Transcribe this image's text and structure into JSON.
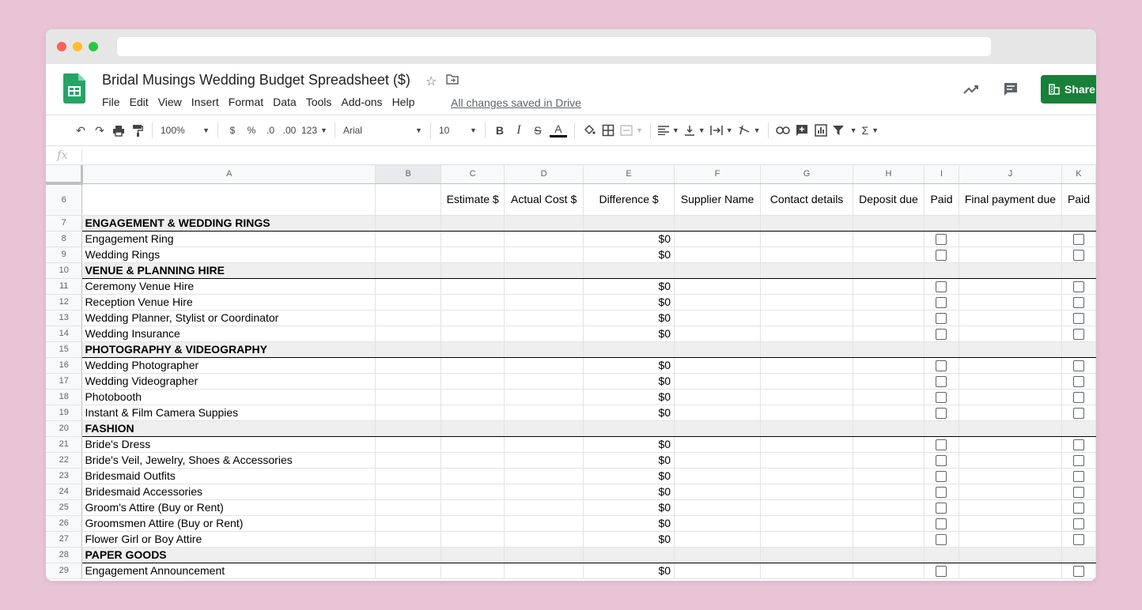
{
  "header": {
    "title": "Bridal Musings Wedding Budget Spreadsheet ($)",
    "menu": [
      "File",
      "Edit",
      "View",
      "Insert",
      "Format",
      "Data",
      "Tools",
      "Add-ons",
      "Help"
    ],
    "saved_status": "All changes saved in Drive",
    "share_label": "Share"
  },
  "toolbar": {
    "zoom": "100%",
    "currency": "$",
    "percent": "%",
    "decrease_decimals": ".0",
    "increase_decimals": ".00",
    "more_formats": "123",
    "font": "Arial",
    "font_size": "10"
  },
  "formula_bar": {
    "fx": "fx"
  },
  "sheet": {
    "columns": [
      "A",
      "B",
      "C",
      "D",
      "E",
      "F",
      "G",
      "H",
      "I",
      "J",
      "K"
    ],
    "header_row": {
      "number": "6",
      "labels": [
        "",
        "",
        "Estimate $",
        "Actual Cost $",
        "Difference $",
        "Supplier Name",
        "Contact details",
        "Deposit due",
        "Paid",
        "Final payment due",
        "Paid"
      ]
    },
    "rows": [
      {
        "n": "7",
        "type": "section",
        "label": "ENGAGEMENT & WEDDING RINGS"
      },
      {
        "n": "8",
        "type": "item",
        "label": "Engagement Ring",
        "diff": "$0"
      },
      {
        "n": "9",
        "type": "item",
        "label": "Wedding Rings",
        "diff": "$0"
      },
      {
        "n": "10",
        "type": "section",
        "label": "VENUE & PLANNING HIRE"
      },
      {
        "n": "11",
        "type": "item",
        "label": "Ceremony Venue Hire",
        "diff": "$0"
      },
      {
        "n": "12",
        "type": "item",
        "label": "Reception Venue Hire",
        "diff": "$0"
      },
      {
        "n": "13",
        "type": "item",
        "label": "Wedding Planner, Stylist or Coordinator",
        "diff": "$0"
      },
      {
        "n": "14",
        "type": "item",
        "label": "Wedding Insurance",
        "diff": "$0"
      },
      {
        "n": "15",
        "type": "section",
        "label": "PHOTOGRAPHY & VIDEOGRAPHY"
      },
      {
        "n": "16",
        "type": "item",
        "label": "Wedding Photographer",
        "diff": "$0"
      },
      {
        "n": "17",
        "type": "item",
        "label": "Wedding Videographer",
        "diff": "$0"
      },
      {
        "n": "18",
        "type": "item",
        "label": "Photobooth",
        "diff": "$0"
      },
      {
        "n": "19",
        "type": "item",
        "label": "Instant & Film Camera Suppies",
        "diff": "$0"
      },
      {
        "n": "20",
        "type": "section",
        "label": "FASHION"
      },
      {
        "n": "21",
        "type": "item",
        "label": "Bride's Dress",
        "diff": "$0"
      },
      {
        "n": "22",
        "type": "item",
        "label": "Bride's Veil, Jewelry, Shoes & Accessories",
        "diff": "$0"
      },
      {
        "n": "23",
        "type": "item",
        "label": "Bridesmaid Outfits",
        "diff": "$0"
      },
      {
        "n": "24",
        "type": "item",
        "label": "Bridesmaid Accessories",
        "diff": "$0"
      },
      {
        "n": "25",
        "type": "item",
        "label": "Groom's Attire (Buy or Rent)",
        "diff": "$0"
      },
      {
        "n": "26",
        "type": "item",
        "label": "Groomsmen Attire (Buy or Rent)",
        "diff": "$0"
      },
      {
        "n": "27",
        "type": "item",
        "label": "Flower Girl or Boy Attire",
        "diff": "$0"
      },
      {
        "n": "28",
        "type": "section",
        "label": "PAPER GOODS"
      },
      {
        "n": "29",
        "type": "item",
        "label": "Engagement Announcement",
        "diff": "$0"
      }
    ]
  },
  "colors": {
    "share": "#188038",
    "section_bg": "#efefef",
    "backdrop": "#e8c4d5"
  }
}
